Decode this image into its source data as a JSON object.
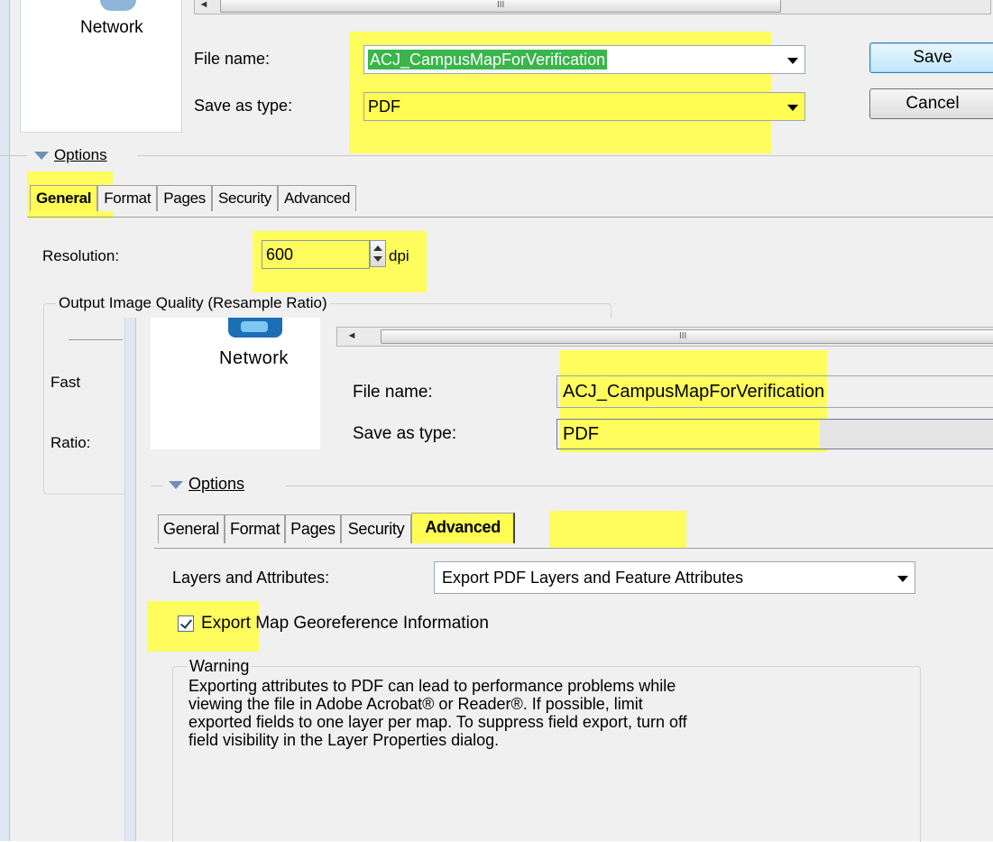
{
  "back": {
    "nav_label": "Network",
    "scroll_grip": "III",
    "file_name_label": "File name:",
    "file_name_value": "ACJ_CampusMapForVerification",
    "save_as_type_label": "Save as type:",
    "save_as_type_value": "PDF",
    "save_label": "Save",
    "cancel_label": "Cancel",
    "options_label": "Options",
    "tabs": [
      "General",
      "Format",
      "Pages",
      "Security",
      "Advanced"
    ],
    "active_tab": "General",
    "resolution_label": "Resolution:",
    "resolution_value": "600",
    "resolution_unit": "dpi",
    "quality_group_title": "Output Image Quality (Resample Ratio)",
    "fast_label": "Fast",
    "ratio_label": "Ratio:"
  },
  "front": {
    "nav_label": "Network",
    "scroll_grip": "III",
    "file_name_label": "File name:",
    "file_name_value": "ACJ_CampusMapForVerification",
    "save_as_type_label": "Save as type:",
    "save_as_type_value": "PDF",
    "options_label": "Options",
    "tabs": [
      "General",
      "Format",
      "Pages",
      "Security",
      "Advanced"
    ],
    "active_tab": "Advanced",
    "layers_label": "Layers and Attributes:",
    "layers_value": "Export PDF Layers and Feature Attributes",
    "georef_label": "Export Map Georeference Information",
    "georef_checked": true,
    "warning_title": "Warning",
    "warning_text": "Exporting attributes to PDF can lead to performance problems while\nviewing the file in Adobe Acrobat® or Reader®.  If possible, limit\nexported fields to one layer per map. To suppress field export, turn off\nfield visibility in the Layer Properties dialog."
  },
  "colors": {
    "highlight": "#fffd54",
    "selection": "#39b54a",
    "dialog_bg": "#f0f0f0"
  }
}
